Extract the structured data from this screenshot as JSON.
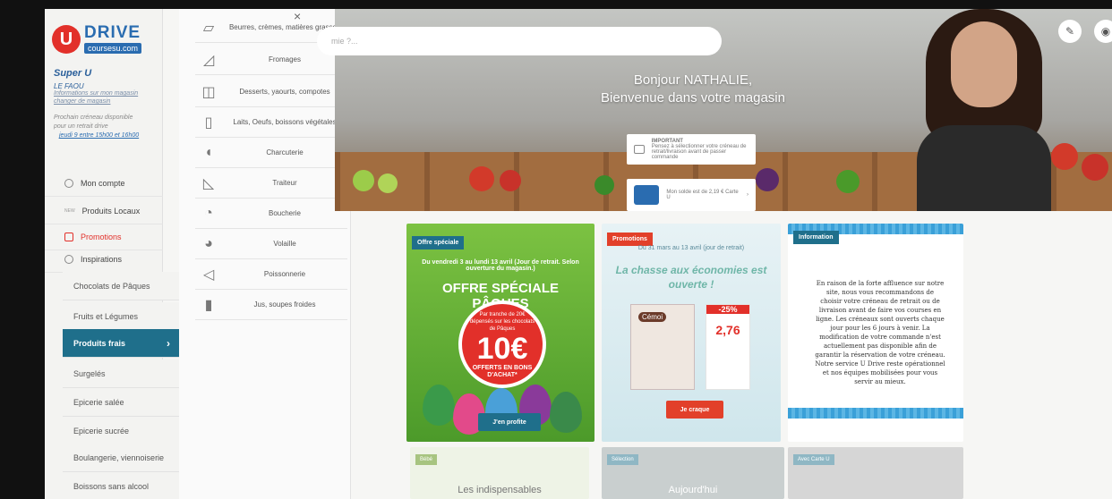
{
  "brand": {
    "logo_letter": "U",
    "logo_name": "DRIVE",
    "logo_site": "coursesu.com"
  },
  "store": {
    "name": "Super U",
    "city": "LE FAOU",
    "info_link": "Informations sur mon magasin",
    "change_link": "changer de magasin",
    "slot_text_1": "Prochain créneau disponible",
    "slot_text_2": "pour un retrait drive",
    "slot_link": "jeudi 9 entre 15h00 et 16h00"
  },
  "account_menu": [
    {
      "label": "Mon compte"
    },
    {
      "label": "Produits Locaux",
      "prefix": "NEW"
    },
    {
      "label": "Promotions"
    },
    {
      "label": "Inspirations"
    }
  ],
  "categories": [
    {
      "label": "Chocolats de Pâques"
    },
    {
      "label": "Fruits et Légumes"
    },
    {
      "label": "Produits frais",
      "active": true
    },
    {
      "label": "Surgelés"
    },
    {
      "label": "Epicerie salée"
    },
    {
      "label": "Epicerie sucrée"
    },
    {
      "label": "Boulangerie, viennoiserie"
    },
    {
      "label": "Boissons sans alcool"
    }
  ],
  "subcategories": [
    {
      "label": "Beurres, crèmes, matières grasses",
      "icon": "butter-icon"
    },
    {
      "label": "Fromages",
      "icon": "cheese-icon"
    },
    {
      "label": "Desserts, yaourts, compotes",
      "icon": "yogurt-icon"
    },
    {
      "label": "Laits, Oeufs, boissons végétales",
      "icon": "milk-icon"
    },
    {
      "label": "Charcuterie",
      "icon": "ham-icon"
    },
    {
      "label": "Traiteur",
      "icon": "pizza-icon"
    },
    {
      "label": "Boucherie",
      "icon": "meat-icon"
    },
    {
      "label": "Volaille",
      "icon": "chicken-icon"
    },
    {
      "label": "Poissonnerie",
      "icon": "fish-icon"
    },
    {
      "label": "Jus, soupes froides",
      "icon": "juice-icon"
    }
  ],
  "search": {
    "placeholder": "mie ?..."
  },
  "hero": {
    "greeting_1": "Bonjour NATHALIE,",
    "greeting_2": "Bienvenue dans votre magasin",
    "important_title": "IMPORTANT",
    "important_text": "Pensez à sélectionner votre créneau de retrait/livraison avant de passer commande",
    "card_text": "Mon solde est de 2,19 € Carte U"
  },
  "cards": {
    "offer": {
      "tag": "Offre spéciale",
      "dates": "Du vendredi 3 au lundi 13 avril (Jour de retrait. Selon ouverture du magasin.)",
      "headline": "OFFRE SPÉCIALE PÂQUES",
      "badge_top": "Par tranche de 20€ dépensés sur les chocolats de Pâques",
      "badge_value": "10€",
      "badge_bottom": "OFFERTS EN BONS D'ACHAT*",
      "cta": "J'en profite"
    },
    "promo": {
      "tag": "Promotions",
      "dates": "Du 31 mars au 13 avril (jour de retrait)",
      "headline": "La chasse aux économies est ouverte !",
      "brand": "Cémoi",
      "discount": "-25%",
      "price": "2,76",
      "cta": "Je craque"
    },
    "info": {
      "tag": "Information",
      "text": "En raison de la forte affluence sur notre site, nous vous recommandons de choisir votre créneau de retrait ou de livraison avant de faire vos courses en ligne. Les créneaux sont ouverts chaque jour pour les 6 jours à venir. La modification de votre commande n'est actuellement pas disponible afin de garantir la réservation de votre créneau. Notre service U Drive reste opérationnel et nos équipes mobilisées pour vous servir au mieux."
    }
  },
  "bottom_tiles": [
    {
      "tag": "Bébé",
      "title": "Les indispensables"
    },
    {
      "tag": "Sélection",
      "title": "Aujourd'hui"
    },
    {
      "tag": "Avec Carte U",
      "title": ""
    }
  ],
  "colors": {
    "brand_blue": "#2a6cb0",
    "brand_red": "#e2302a",
    "active_teal": "#1f6f8b"
  }
}
